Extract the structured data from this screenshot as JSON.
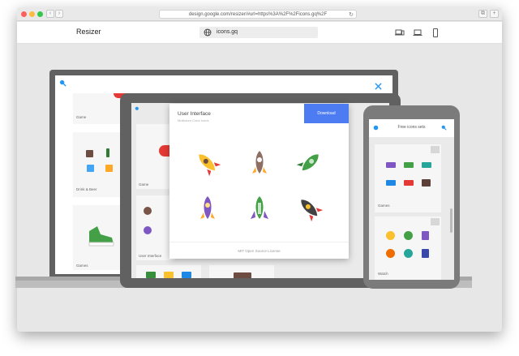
{
  "browser": {
    "url": "design.google.com/resizer/#url=https%3A%2F%2Ficons.gq%2F"
  },
  "app": {
    "title": "Resizer",
    "site_field": "icons.gq"
  },
  "laptop_page": {
    "cards": [
      "Game",
      "Drink & Beer",
      "Games"
    ]
  },
  "tablet_page": {
    "cards": [
      "Game",
      "User Interface"
    ]
  },
  "dialog": {
    "title": "User Interface",
    "subtitle": "Multiclour Color Icons",
    "download_label": "Download",
    "footer": "MIT Open Source License"
  },
  "phone_page": {
    "header": "Free icons sets",
    "cards": [
      "Games",
      "Watch"
    ]
  },
  "colors": {
    "accent": "#4d7cf2",
    "brand_blue": "#2196f3",
    "device_frame": "#616161"
  }
}
